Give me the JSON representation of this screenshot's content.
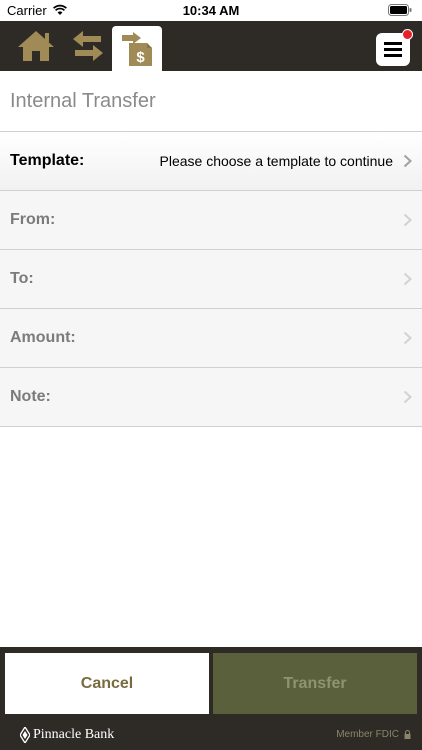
{
  "status_bar": {
    "carrier": "Carrier",
    "time": "10:34 AM"
  },
  "nav": {
    "icons": [
      "home-icon",
      "swap-arrows-icon",
      "transfer-dollar-icon",
      "hamburger-menu-icon"
    ],
    "active_tab": "transfer-dollar-icon",
    "notification_color": "#e5222a",
    "accent_gold": "#a08a55"
  },
  "page": {
    "title": "Internal Transfer"
  },
  "form": {
    "template": {
      "label": "Template:",
      "value": "Please choose a template to continue"
    },
    "from": {
      "label": "From:"
    },
    "to": {
      "label": "To:"
    },
    "amount": {
      "label": "Amount:"
    },
    "note": {
      "label": "Note:"
    }
  },
  "buttons": {
    "cancel_label": "Cancel",
    "transfer_label": "Transfer"
  },
  "footer": {
    "brand": "Pinnacle Bank",
    "fdic": "Member FDIC"
  }
}
